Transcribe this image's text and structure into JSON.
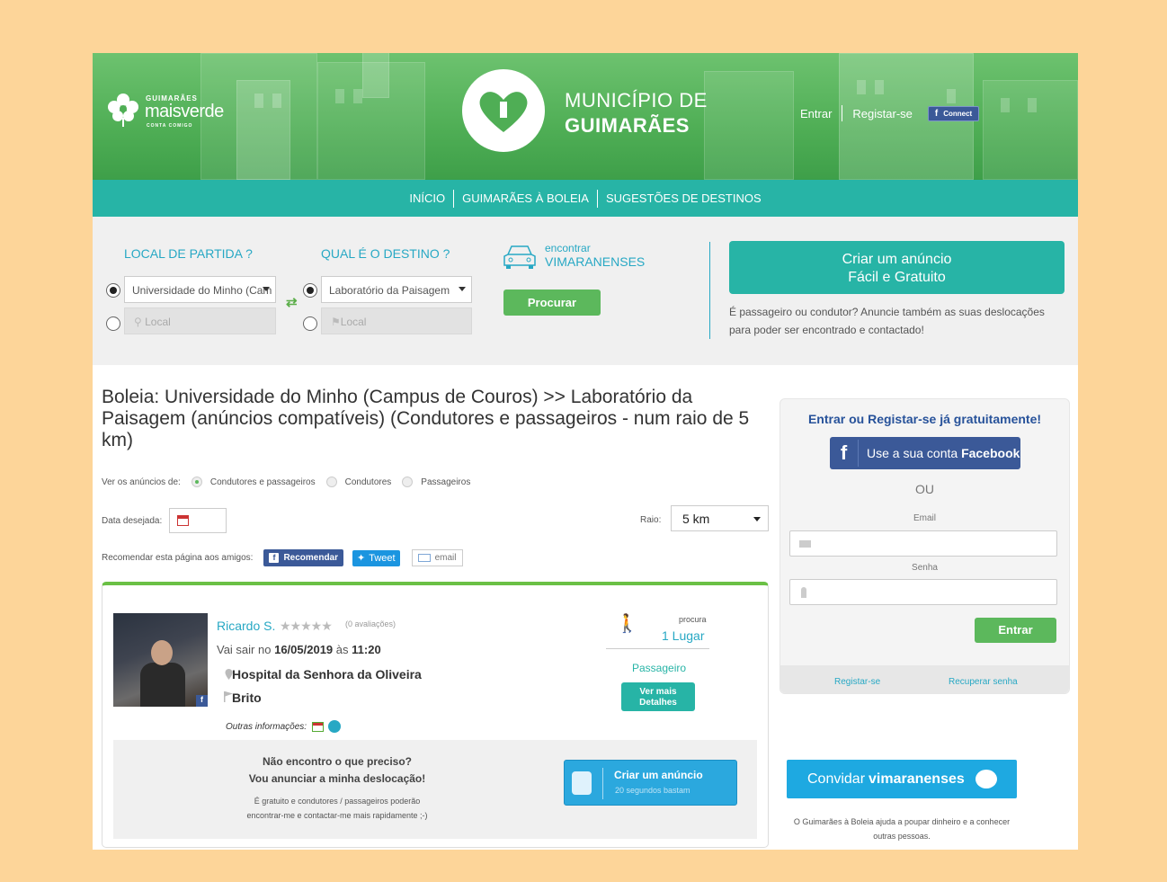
{
  "header": {
    "brand": {
      "top": "GUIMARÃES",
      "name": "maisverde",
      "tagline": "CONTA COMIGO"
    },
    "municipality": {
      "line1": "MUNICÍPIO DE",
      "line2": "GUIMARÃES"
    },
    "links": {
      "login": "Entrar",
      "register": "Registar-se",
      "fb_connect": "Connect"
    }
  },
  "nav": {
    "items": [
      "INÍCIO",
      "GUIMARÃES À BOLEIA",
      "SUGESTÕES DE DESTINOS"
    ]
  },
  "search": {
    "origin_label": "LOCAL DE PARTIDA ?",
    "destination_label": "QUAL É O DESTINO ?",
    "origin_select": "Universidade do Minho (Cam",
    "origin_placeholder": "Local",
    "destination_select": "Laboratório da Paisagem",
    "destination_placeholder": "Local",
    "find_line1": "encontrar",
    "find_line2": "VIMARANENSES",
    "search_button": "Procurar"
  },
  "create_ad": {
    "line1": "Criar um anúncio",
    "line2": "Fácil e Gratuito",
    "description": "É passageiro ou condutor? Anuncie também as suas deslocações para poder ser encontrado e contactado!"
  },
  "results": {
    "title": "Boleia: Universidade do Minho (Campus de Couros) >> Laboratório da Paisagem (anúncios compatíveis) (Condutores e passageiros - num raio de 5 km)",
    "filter_label": "Ver os anúncios de:",
    "filters": [
      "Condutores e passageiros",
      "Condutores",
      "Passageiros"
    ],
    "date_label": "Data desejada:",
    "radius_label": "Raio:",
    "radius_value": "5 km",
    "share_label": "Recomendar esta página aos amigos:",
    "share_fb": "Recomendar",
    "share_tweet": "Tweet",
    "share_email": "email"
  },
  "listing": {
    "name": "Ricardo S.",
    "stars": "★★★★★",
    "reviews": "(0 avaliações)",
    "depart_prefix": "Vai sair no",
    "depart_date": "16/05/2019",
    "depart_mid": "às",
    "depart_time": "11:20",
    "origin": "Hospital da Senhora da Oliveira",
    "destination": "Brito",
    "more_info": "Outras informações:",
    "searches_label": "procura",
    "seats": "1 Lugar",
    "role": "Passageiro",
    "details_l1": "Ver mais",
    "details_l2": "Detalhes"
  },
  "prompt": {
    "line1": "Não encontro o que preciso?",
    "line2": "Vou anunciar a minha deslocação!",
    "line3": "É gratuito e condutores / passageiros poderão",
    "line4": "encontrar-me e contactar-me mais rapidamente ;-)",
    "button_title": "Criar um anúncio",
    "button_sub": "20 segundos bastam"
  },
  "login": {
    "title": "Entrar ou Registar-se já gratuitamente!",
    "fb_text": "Use a sua conta",
    "fb_bold": "Facebook",
    "or": "OU",
    "email_label": "Email",
    "password_label": "Senha",
    "submit": "Entrar",
    "register": "Registar-se",
    "recover": "Recuperar senha"
  },
  "invite": {
    "text": "Convidar",
    "bold": "vimaranenses",
    "description": "O Guimarães à Boleia ajuda a poupar dinheiro e a conhecer outras pessoas."
  },
  "colors": {
    "page_bg": "#fdd599",
    "teal": "#27b4a6",
    "green": "#5cb85c",
    "link_blue": "#27a8c4",
    "facebook": "#3b5998",
    "invite_blue": "#1ea9e1"
  }
}
